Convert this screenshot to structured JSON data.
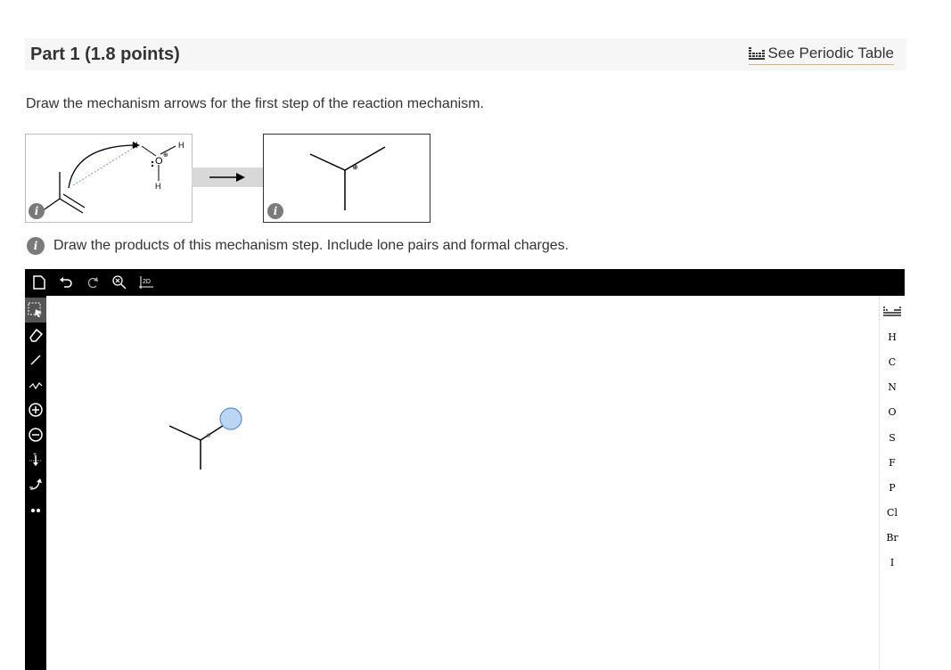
{
  "header": {
    "part_title": "Part 1   (1.8 points)",
    "periodic_table_link": "See Periodic Table"
  },
  "instruction": "Draw the mechanism arrows for the first step of the reaction mechanism.",
  "reaction": {
    "reactant_atoms": {
      "h_top": "H",
      "o": "O",
      "h_right": "H",
      "h_bottom": "H",
      "charge_o": "⊕"
    },
    "product_charge": "⊕",
    "info_glyph": "i"
  },
  "prompt": "Draw the products of this mechanism step. Include lone pairs and formal charges.",
  "editor": {
    "top_tools": [
      "new-document",
      "undo",
      "redo",
      "zoom-clear",
      "2d-clean"
    ],
    "top_tool_2d_label": "2D",
    "left_tools": [
      "select",
      "erase",
      "single-bond",
      "chain",
      "positive-charge",
      "negative-charge",
      "arrow",
      "curved-arrow",
      "lone-pair"
    ],
    "elements": [
      "H",
      "C",
      "N",
      "O",
      "S",
      "F",
      "P",
      "Cl",
      "Br",
      "I"
    ],
    "canvas_charge": "⊕"
  }
}
